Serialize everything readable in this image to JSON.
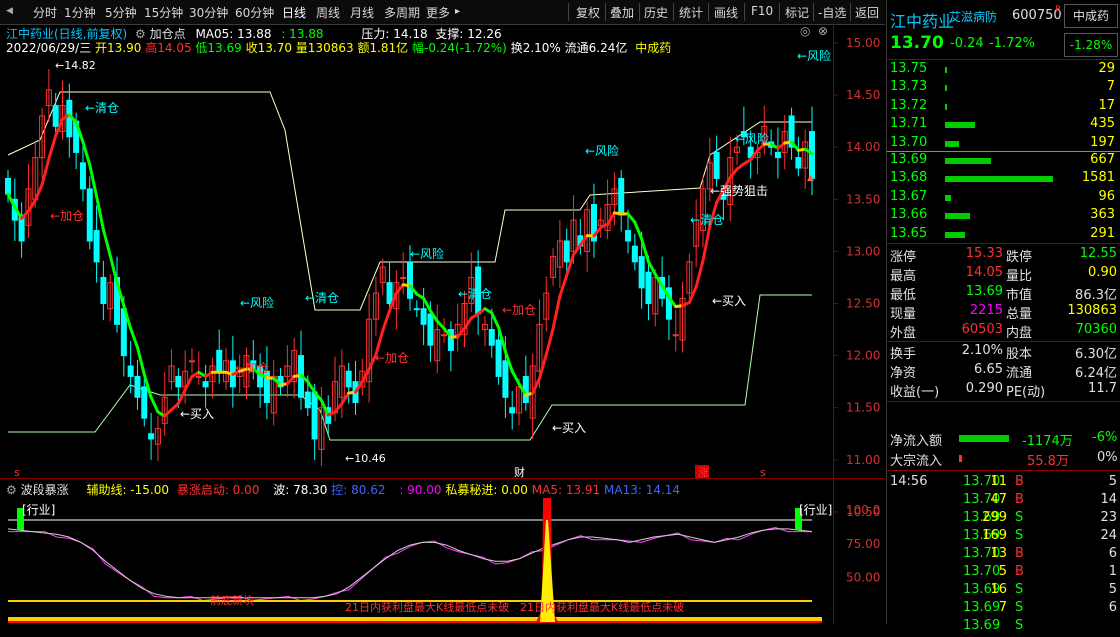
{
  "toolbar": {
    "periods": [
      "分时",
      "1分钟",
      "5分钟",
      "15分钟",
      "30分钟",
      "60分钟",
      "日线",
      "周线",
      "月线",
      "多周期",
      "更多"
    ],
    "active_period": "日线",
    "right_items": [
      "复权",
      "叠加",
      "历史",
      "统计",
      "画线",
      "F10",
      "标记",
      "-自选",
      "返回"
    ]
  },
  "info": {
    "line1": "江中药业(日线,前复权)",
    "indicator_name": "加仓点",
    "ma5_label": "MA05: 13.88",
    "ma5_val2": ": 13.88",
    "pressure": "压力: 14.18",
    "support": "支撑: 12.26",
    "line2_date": "2022/06/29/三",
    "open": "开13.90",
    "high": "高14.05",
    "low": "低13.69",
    "close": "收13.70",
    "vol": "量130863",
    "amount": "额1.81亿",
    "change": "幅-0.24(-1.72%)",
    "turnover": "换2.10%",
    "float_cap": "流通6.24亿",
    "sector": "中成药"
  },
  "price_axis": [
    "15.00",
    "14.50",
    "14.00",
    "13.50",
    "13.00",
    "12.50",
    "12.00",
    "11.50",
    "11.00",
    "10.50"
  ],
  "chart_marks": {
    "high_label": "14.82",
    "low_label": "10.46",
    "signals": [
      {
        "text": "清仓",
        "color": "#00ffff"
      },
      {
        "text": "加仓",
        "color": "#ff3030"
      },
      {
        "text": "风险",
        "color": "#00ffff"
      },
      {
        "text": "买入",
        "color": "#ffffff"
      },
      {
        "text": "加仓",
        "color": "#ff3030"
      },
      {
        "text": "清仓",
        "color": "#00ffff"
      },
      {
        "text": "加仓",
        "color": "#ff3030"
      },
      {
        "text": "风险",
        "color": "#00ffff"
      },
      {
        "text": "清仓",
        "color": "#00ffff"
      },
      {
        "text": "加仓",
        "color": "#ff3030"
      },
      {
        "text": "买入",
        "color": "#ffffff"
      },
      {
        "text": "风险",
        "color": "#00ffff"
      },
      {
        "text": "清仓",
        "color": "#00ffff"
      },
      {
        "text": "买入",
        "color": "#ffffff"
      },
      {
        "text": "强势狙击",
        "color": "#ffffff"
      },
      {
        "text": "风险",
        "color": "#00ffff"
      },
      {
        "text": "风险",
        "color": "#00ffff"
      }
    ],
    "bottom_tags": [
      "s",
      "财",
      "涨",
      "s"
    ]
  },
  "sub": {
    "name": "波段暴涨",
    "aux": "辅助线: -15.00",
    "surge": "暴涨启动: 0.00",
    "wave": "波: 78.30",
    "obj": "控: 80.62",
    "val90": ": 90.00",
    "secret": "私募秘进: 0.00",
    "ma5": "MA5: 13.91",
    "ma13": "MA13: 14.14",
    "axis": [
      "100.0",
      "75.00",
      "50.00"
    ],
    "tag_left": "行业",
    "tag_right": "行业",
    "bottom_text1": "前底新块",
    "bottom_text2": "21日内获利盘最大K线最低点未破",
    "bottom_text3": "21日内获利盘最大K线最低点未破"
  },
  "quote": {
    "name": "江中药业",
    "tag": "艾滋病防",
    "code": "600750",
    "r": "R",
    "sector": "中成药",
    "price": "13.70",
    "chg": "-0.24",
    "pct": "-1.72%",
    "sector_pct": "-1.28%",
    "asks": [
      {
        "p": "13.75",
        "v": "29",
        "bar": 2
      },
      {
        "p": "13.73",
        "v": "7",
        "bar": 2
      },
      {
        "p": "13.72",
        "v": "17",
        "bar": 2
      },
      {
        "p": "13.71",
        "v": "435",
        "bar": 30
      },
      {
        "p": "13.70",
        "v": "197",
        "bar": 14
      }
    ],
    "bids": [
      {
        "p": "13.69",
        "v": "667",
        "bar": 46
      },
      {
        "p": "13.68",
        "v": "1581",
        "bar": 108
      },
      {
        "p": "13.67",
        "v": "96",
        "bar": 6
      },
      {
        "p": "13.66",
        "v": "363",
        "bar": 25
      },
      {
        "p": "13.65",
        "v": "291",
        "bar": 20
      }
    ],
    "stats": [
      {
        "l1": "涨停",
        "v1": "15.33",
        "c1": "#ff3030",
        "l2": "跌停",
        "v2": "12.55",
        "c2": "#00ff00"
      },
      {
        "l1": "最高",
        "v1": "14.05",
        "c1": "#ff3030",
        "l2": "量比",
        "v2": "0.90",
        "c2": "#ffff00"
      },
      {
        "l1": "最低",
        "v1": "13.69",
        "c1": "#00ff00",
        "l2": "市值",
        "v2": "86.3亿",
        "c2": "#e0e0e0"
      },
      {
        "l1": "现量",
        "v1": "2215",
        "c1": "#ff00ff",
        "l2": "总量",
        "v2": "130863",
        "c2": "#ffff00"
      },
      {
        "l1": "外盘",
        "v1": "60503",
        "c1": "#ff3030",
        "l2": "内盘",
        "v2": "70360",
        "c2": "#00ff00"
      }
    ],
    "stats2": [
      {
        "l1": "换手",
        "v1": "2.10%",
        "l2": "股本",
        "v2": "6.30亿"
      },
      {
        "l1": "净资",
        "v1": "6.65",
        "l2": "流通",
        "v2": "6.24亿"
      },
      {
        "l1": "收益(一)",
        "v1": "0.290",
        "l2": "PE(动)",
        "v2": "11.7"
      }
    ],
    "inflow_label": "净流入额",
    "inflow_val": "-1174万",
    "inflow_pct": "-6%",
    "block_label": "大宗流入",
    "block_val": "55.8万",
    "block_pct": "0%",
    "ticks": [
      {
        "t": "14:56",
        "p": "13.70",
        "v": "11",
        "s": "B",
        "n": "5"
      },
      {
        "t": "",
        "p": "13.70",
        "v": "47",
        "s": "B",
        "n": "14"
      },
      {
        "t": "",
        "p": "13.69",
        "v": "299",
        "s": "S",
        "n": "23"
      },
      {
        "t": "",
        "p": "13.69",
        "v": "169",
        "s": "S",
        "n": "24"
      },
      {
        "t": "",
        "p": "13.70",
        "v": "13",
        "s": "B",
        "n": "6"
      },
      {
        "t": "",
        "p": "13.70",
        "v": "5",
        "s": "B",
        "n": "1"
      },
      {
        "t": "",
        "p": "13.69",
        "v": "16",
        "s": "S",
        "n": "5"
      },
      {
        "t": "",
        "p": "13.69",
        "v": "7",
        "s": "S",
        "n": "6"
      },
      {
        "t": "",
        "p": "13.69",
        "v": "",
        "s": "S",
        "n": ""
      }
    ]
  },
  "colors": {
    "up": "#ff3030",
    "down": "#00ffff",
    "ma_up": "#ff2020",
    "ma_mid": "#ffcc00",
    "ma_down": "#00ff00",
    "bg": "#000000"
  }
}
